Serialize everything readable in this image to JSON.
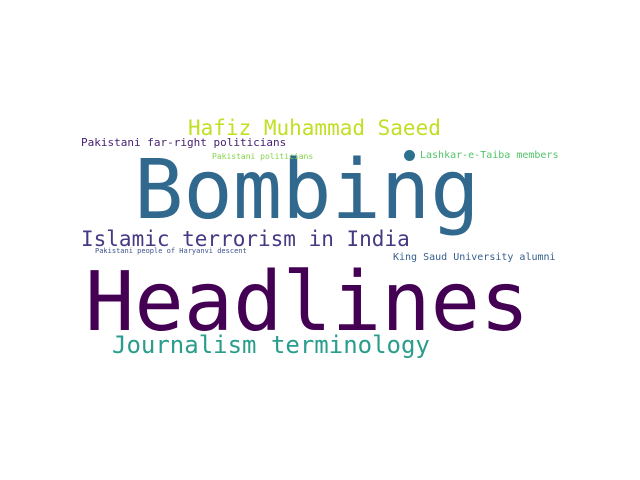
{
  "words": [
    {
      "id": "headlines",
      "text": "Headlines",
      "color": "#440154"
    },
    {
      "id": "bombing",
      "text": "Bombing",
      "color": "#31688e"
    },
    {
      "id": "journalism",
      "text": "Journalism terminology",
      "color": "#2a9d8c"
    },
    {
      "id": "islamic",
      "text": "Islamic terrorism in India",
      "color": "#443983"
    },
    {
      "id": "hafiz",
      "text": "Hafiz Muhammad Saeed",
      "color": "#c2df23"
    },
    {
      "id": "farright",
      "text": "Pakistani far-right politicians",
      "color": "#482173"
    },
    {
      "id": "lashkar",
      "text": "Lashkar-e-Taiba members",
      "color": "#52c569"
    },
    {
      "id": "pkpol",
      "text": "Pakistani politicians",
      "color": "#86d549"
    },
    {
      "id": "haryanvi",
      "text": "Pakistani people of Haryanvi descent",
      "color": "#3b528b"
    },
    {
      "id": "kingsaud",
      "text": "King Saud University alumni",
      "color": "#355f8d"
    }
  ],
  "dot_color": "#2c728e"
}
